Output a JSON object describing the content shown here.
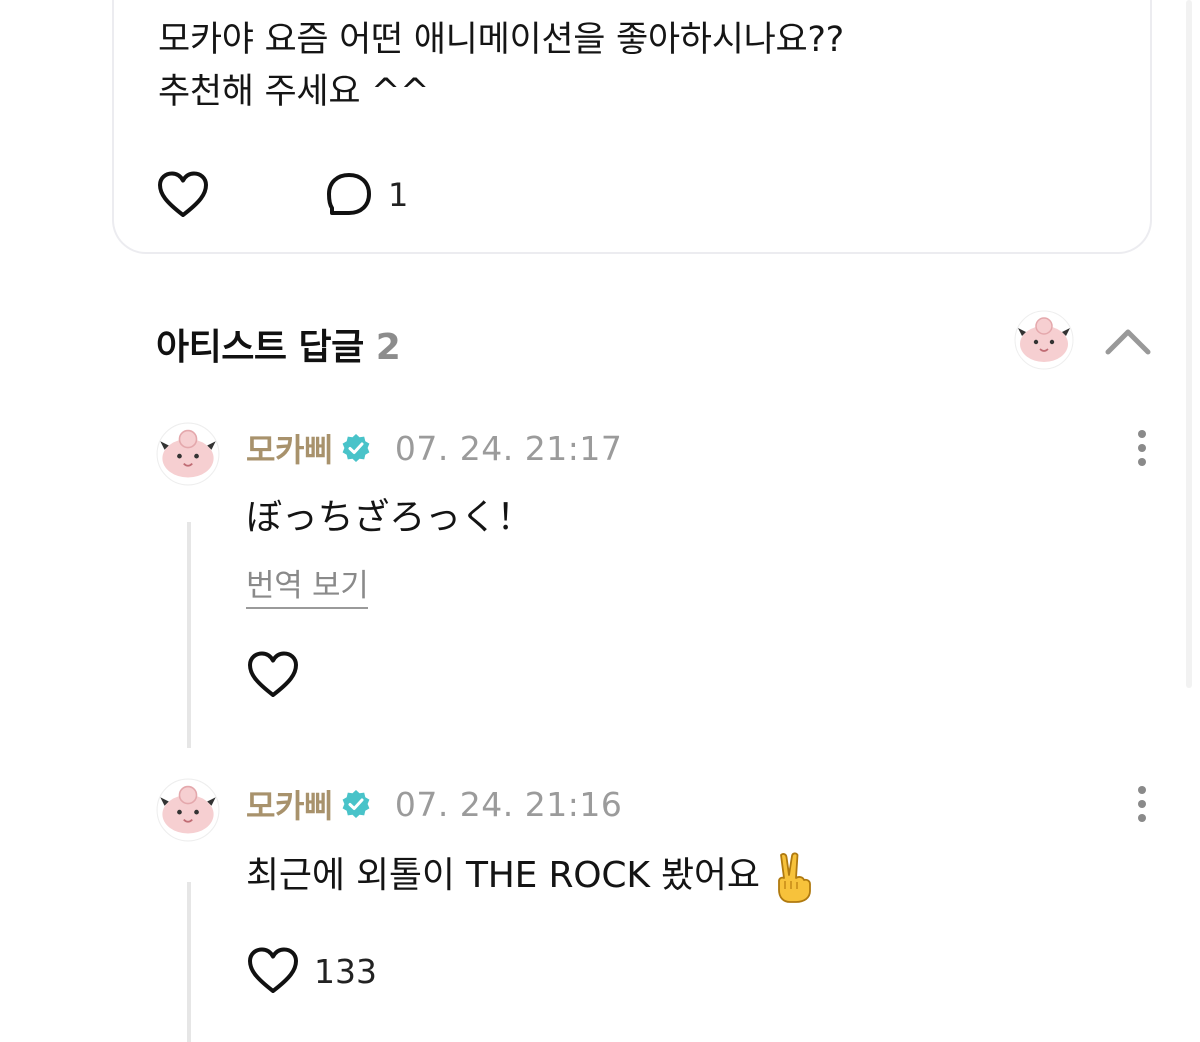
{
  "post": {
    "line1": "모카야 요즘 어떤 애니메이션을 좋아하시나요??",
    "line2": "추천해 주세요 ^^",
    "comment_count": "1"
  },
  "section": {
    "title": "아티스트 답글",
    "count": "2"
  },
  "replies": [
    {
      "name": "모카삐",
      "time": "07. 24. 21:17",
      "text": "ぼっちざろっく！",
      "translate_label": "번역 보기",
      "likes": ""
    },
    {
      "name": "모카삐",
      "time": "07. 24. 21:16",
      "text": "최근에 외톨이 THE ROCK 봤어요",
      "likes": "133"
    }
  ],
  "colors": {
    "artist_name": "#a8926c",
    "verified": "#49c3c9",
    "timestamp": "#9b9b9b"
  },
  "icons": [
    "heart-icon",
    "speech-bubble-icon",
    "chevron-up-icon",
    "verified-badge-icon",
    "more-vertical-icon",
    "victory-hand-emoji"
  ]
}
